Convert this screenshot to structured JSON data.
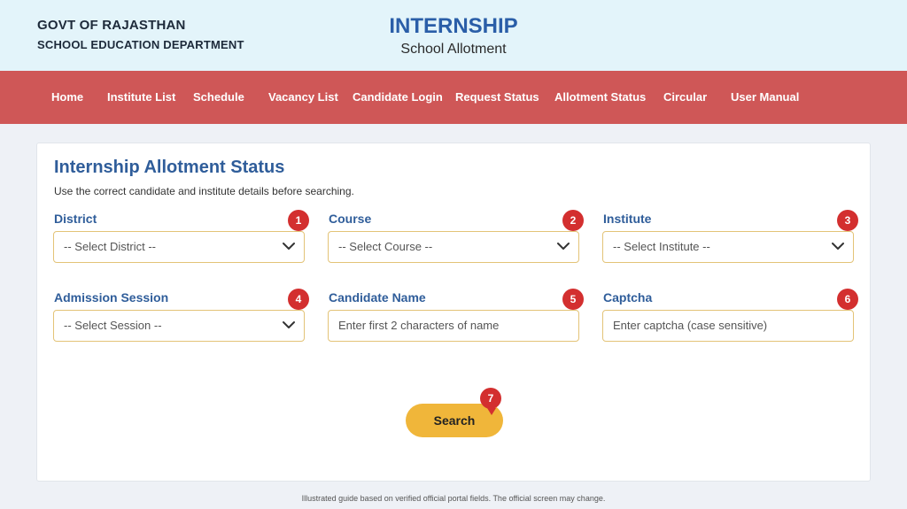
{
  "header": {
    "org_line1": "GOVT OF RAJASTHAN",
    "org_line2": "SCHOOL EDUCATION DEPARTMENT",
    "title": "INTERNSHIP",
    "subtitle": "School Allotment"
  },
  "nav": {
    "items": [
      {
        "label": "Home"
      },
      {
        "label": "Institute List"
      },
      {
        "label": "Schedule"
      },
      {
        "label": "Vacancy List"
      },
      {
        "label": "Candidate Login"
      },
      {
        "label": "Request Status"
      },
      {
        "label": "Allotment Status"
      },
      {
        "label": "Circular"
      },
      {
        "label": "User Manual"
      }
    ]
  },
  "form": {
    "title": "Internship Allotment Status",
    "note": "Use the correct candidate and institute details before searching.",
    "fields": [
      {
        "label": "District",
        "value": "-- Select District --",
        "badge": "1",
        "kind": "select"
      },
      {
        "label": "Course",
        "value": "-- Select Course --",
        "badge": "2",
        "kind": "select"
      },
      {
        "label": "Institute",
        "value": "-- Select Institute --",
        "badge": "3",
        "kind": "select"
      },
      {
        "label": "Admission Session",
        "value": "-- Select Session --",
        "badge": "4",
        "kind": "select"
      },
      {
        "label": "Candidate Name",
        "placeholder": "Enter first 2 characters of name",
        "badge": "5",
        "kind": "input"
      },
      {
        "label": "Captcha",
        "placeholder": "Enter captcha (case sensitive)",
        "badge": "6",
        "kind": "input"
      }
    ],
    "search_label": "Search",
    "search_badge": "7"
  },
  "footer": {
    "text": "Illustrated guide based on verified official portal fields. The official screen may change."
  },
  "colors": {
    "topbar_bg": "#e3f4fa",
    "nav_bg": "#cf5757",
    "title_blue": "#2a5ea8",
    "label_blue": "#2f5d9a",
    "badge_red": "#d32f2f",
    "button_amber": "#f0b63a",
    "control_border": "#e3c377"
  }
}
